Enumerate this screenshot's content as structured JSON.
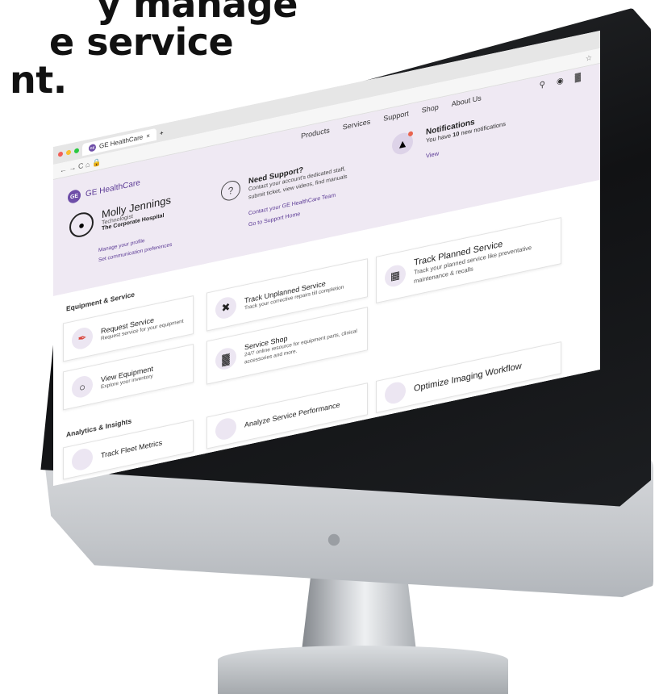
{
  "headline": {
    "line1": "y manage",
    "line2": "e service",
    "line3": "nt."
  },
  "browser": {
    "tab_title": "GE HealthCare",
    "tab_close": "×",
    "tab_new": "+",
    "url_controls": "← → C ⌂ 🔒",
    "star": "☆"
  },
  "nav": {
    "items": [
      "Products",
      "Services",
      "Support",
      "Shop",
      "About Us"
    ],
    "icons": [
      "search-icon",
      "account-icon",
      "cart-icon"
    ]
  },
  "brand": {
    "name": "GE HealthCare",
    "logo_text": "GE",
    "color": "#6e4ea8"
  },
  "profile": {
    "name": "Molly Jennings",
    "role": "Technologist",
    "org": "The Corporate Hospital",
    "links": [
      "Manage your profile",
      "Set communication preferences"
    ]
  },
  "support": {
    "title": "Need Support?",
    "desc": "Contact your account's dedicated staff, submit ticket, view videos, find manuals",
    "links": [
      "Contact your GE HealthCare Team",
      "Go to Support Home"
    ]
  },
  "notifications": {
    "title": "Notifications",
    "desc_prefix": "You have ",
    "count": "10",
    "desc_suffix": " new notifications",
    "view": "View"
  },
  "sections": {
    "equipment": "Equipment & Service",
    "analytics": "Analytics & Insights"
  },
  "cards": {
    "request": {
      "title": "Request Service",
      "desc": "Request service for your equipment"
    },
    "unplanned": {
      "title": "Track Unplanned Service",
      "desc": "Track your corrective repairs till completion"
    },
    "planned": {
      "title": "Track Planned Service",
      "desc": "Track your planned service like preventative maintenance & recalls"
    },
    "equipment": {
      "title": "View Equipment",
      "desc": "Explore your inventory"
    },
    "shop": {
      "title": "Service Shop",
      "desc": "24/7 online resource for equipment parts, clinical accessories and more."
    },
    "fleet": {
      "title": "Track Fleet Metrics"
    },
    "performance": {
      "title": "Analyze Service Performance"
    },
    "imaging": {
      "title": "Optimize Imaging Workflow"
    }
  },
  "colors": {
    "accent": "#5b3a95",
    "hero_bg": "#efe9f3",
    "badge": "#e8644f"
  }
}
